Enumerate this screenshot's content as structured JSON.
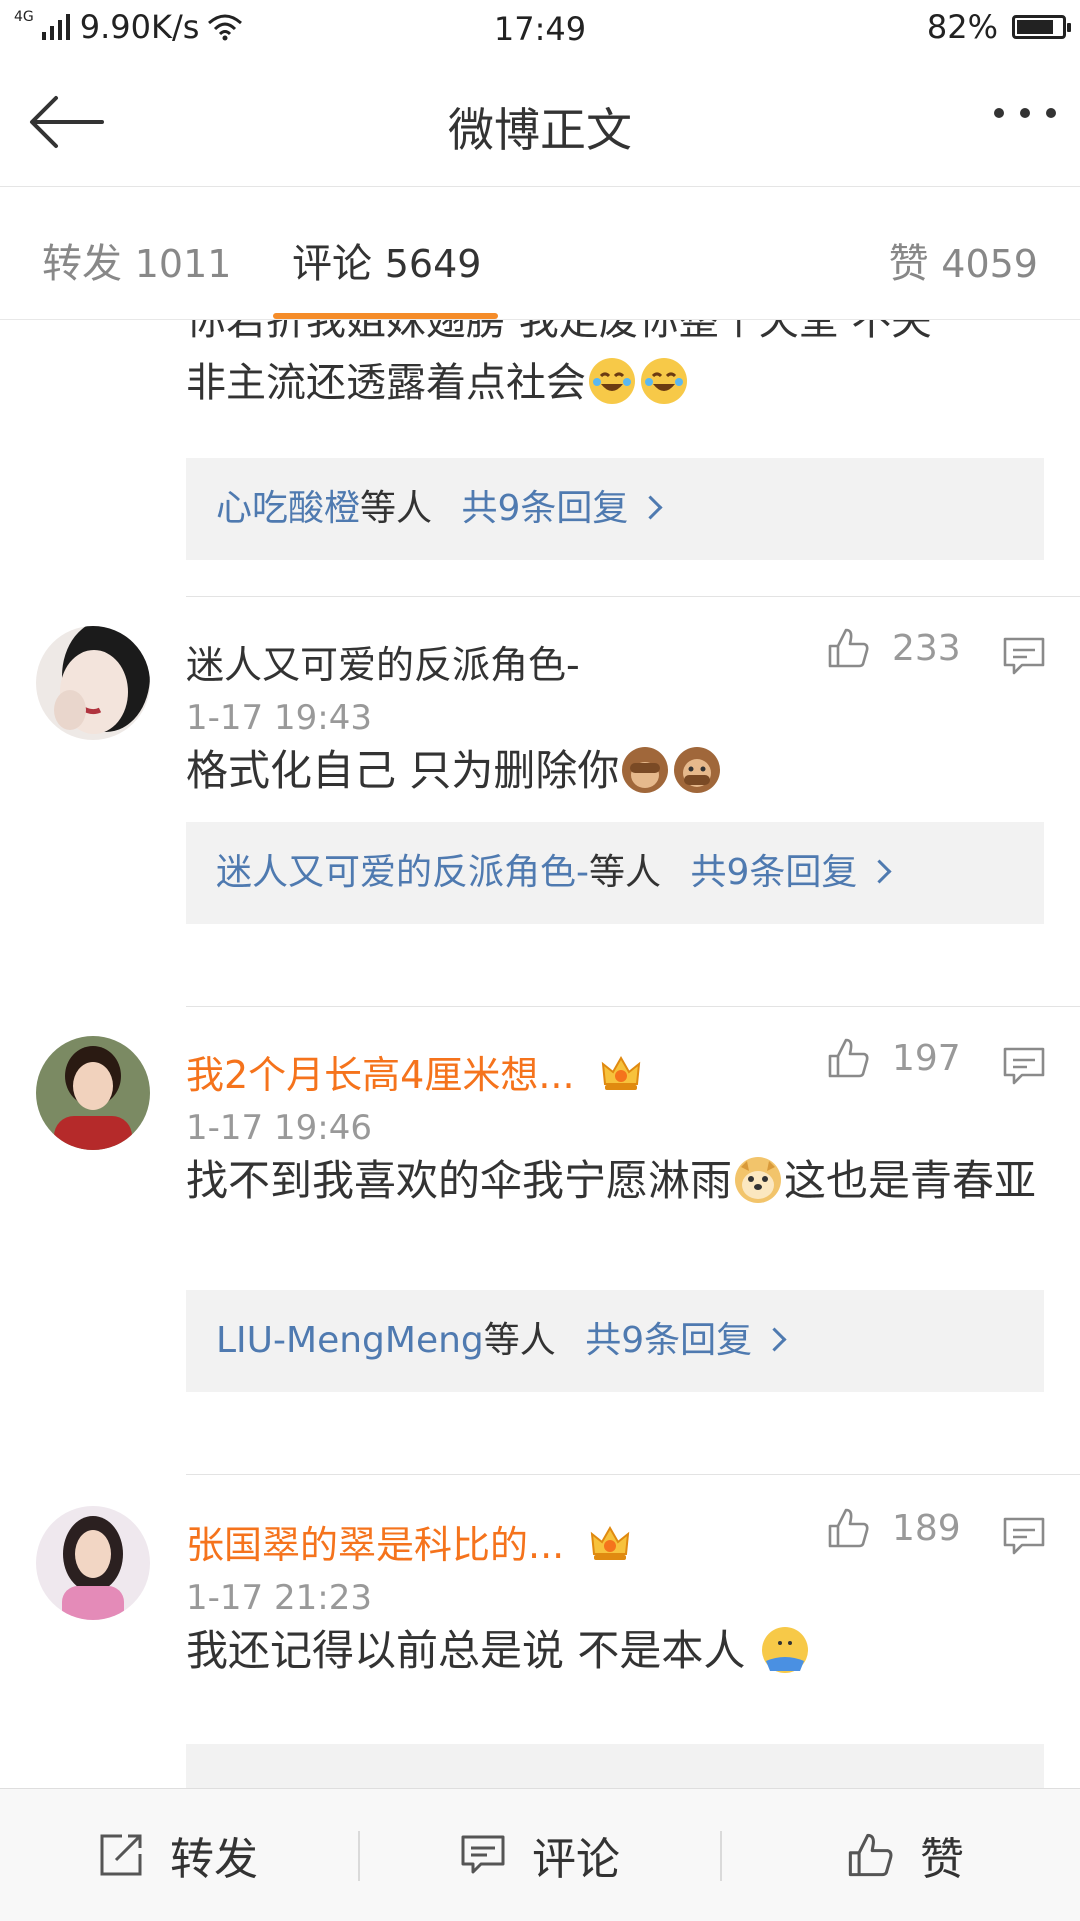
{
  "status_bar": {
    "network": "4G",
    "speed": "9.90K/s",
    "time": "17:49",
    "battery": "82%",
    "battery_level": 0.82
  },
  "nav": {
    "title": "微博正文"
  },
  "tabs": {
    "repost": {
      "label": "转发",
      "count": "1011"
    },
    "comments": {
      "label": "评论",
      "count": "5649"
    },
    "likes": {
      "label": "赞",
      "count": "4059"
    }
  },
  "partial_comment": {
    "text_line1": "你若折我姐妹翅膀 我走废你整个天堂 不失",
    "text_line2": "非主流还透露着点社会",
    "emoji": "laughing-tears-emoji",
    "reply": {
      "users": "心吃酸橙",
      "suffix": "等人",
      "total": "共9条回复"
    }
  },
  "comments": [
    {
      "name": "迷人又可爱的反派角色-",
      "time": "1-17 19:43",
      "likes": "233",
      "text": "格式化自己 只为删除你",
      "emoji": "see-no-evil-monkey-emoji",
      "reply": {
        "users": "迷人又可爱的反派角色-",
        "suffix": "等人",
        "total": "共9条回复"
      }
    },
    {
      "name": "我2个月长高4厘米想...",
      "vip": true,
      "time": "1-17 19:46",
      "likes": "197",
      "text_a": "找不到我喜欢的伞我宁愿淋雨",
      "text_b": "这也是青春亚",
      "emoji": "doge-emoji",
      "reply": {
        "users": "LIU-MengMeng",
        "suffix": "等人",
        "total": "共9条回复"
      }
    },
    {
      "name": "张国翠的翠是科比的...",
      "vip": true,
      "time": "1-17 21:23",
      "likes": "189",
      "text": "我还记得以前总是说 不是本人",
      "emoji": "shrug-emoji"
    }
  ],
  "bottom_bar": {
    "repost": "转发",
    "comment": "评论",
    "like": "赞"
  },
  "colors": {
    "accent": "#f58c29",
    "link": "#4f7ab0",
    "vip_name": "#f5731c"
  }
}
